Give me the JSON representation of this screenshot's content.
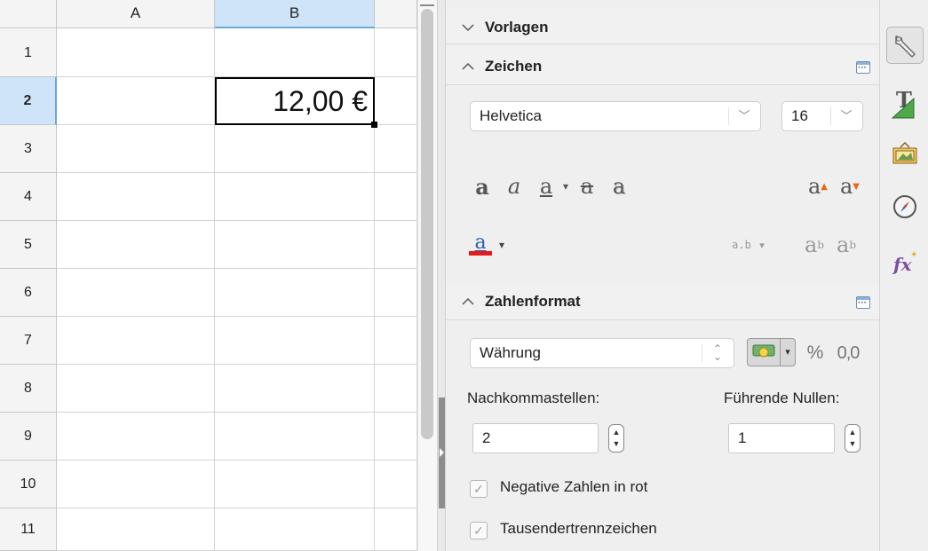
{
  "sheet": {
    "columns": [
      "A",
      "B"
    ],
    "rows": [
      "1",
      "2",
      "3",
      "4",
      "5",
      "6",
      "7",
      "8",
      "9",
      "10",
      "11"
    ],
    "selected_column": "B",
    "selected_row": "2",
    "active_cell_value": "12,00 €"
  },
  "sidebar": {
    "sections": {
      "templates": "Vorlagen",
      "character": "Zeichen",
      "number_format": "Zahlenformat"
    },
    "font_name": "Helvetica",
    "font_size": "16",
    "format_type": "Währung",
    "percent_symbol": "%",
    "decimal_symbol": "0,0",
    "decimal_places_label": "Nachkommastellen:",
    "decimal_places_value": "2",
    "leading_zeros_label": "Führende Nullen:",
    "leading_zeros_value": "1",
    "negative_red_label": "Negative Zahlen in rot",
    "thousands_sep_label": "Tausendertrennzeichen",
    "negative_red_checked": true,
    "thousands_sep_checked": true
  },
  "colors": {
    "selection_header": "#cfe4f8",
    "font_color_bar": "#e31b1b",
    "panel_bg": "#efefef"
  },
  "icons": [
    "bold-icon",
    "italic-icon",
    "underline-icon",
    "strikethrough-icon",
    "shadow-icon",
    "grow-font-icon",
    "shrink-font-icon",
    "font-color-icon",
    "spacing-icon",
    "superscript-icon",
    "subscript-icon",
    "properties-icon",
    "styles-icon",
    "gallery-icon",
    "navigator-icon",
    "functions-icon"
  ]
}
